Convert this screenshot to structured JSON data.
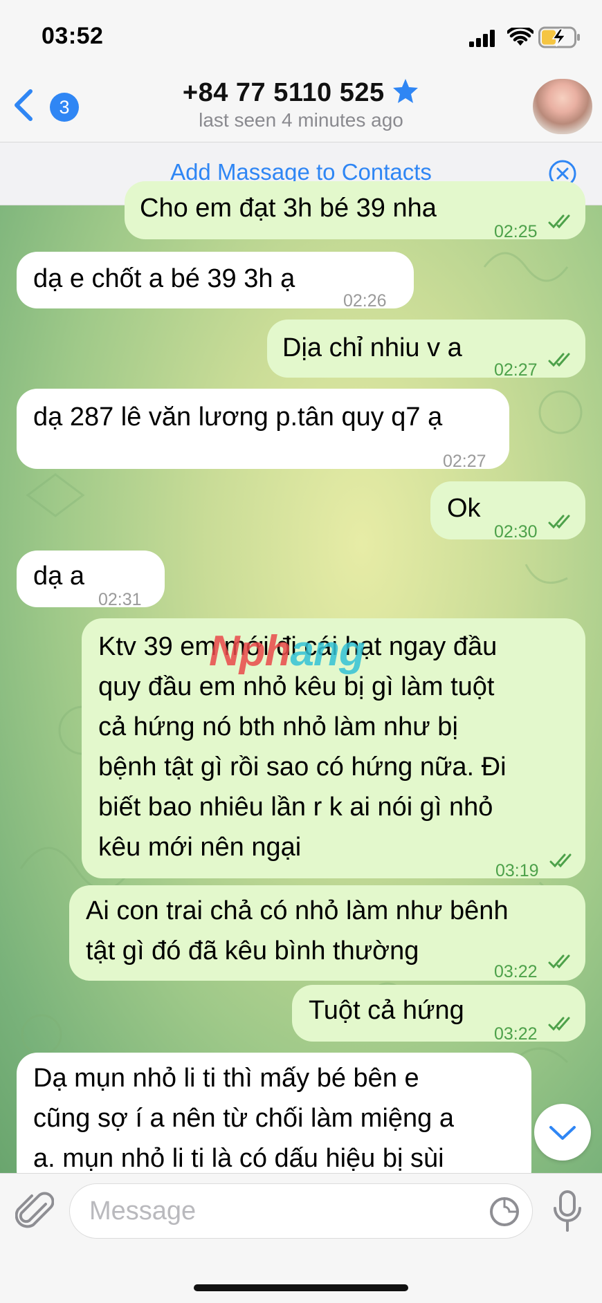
{
  "status_bar": {
    "time": "03:52"
  },
  "header": {
    "back_count": "3",
    "contact_name": "+84 77 5110 525",
    "last_seen": "last seen 4 minutes ago"
  },
  "contact_bar": {
    "add_label": "Add Massage to Contacts"
  },
  "messages": [
    {
      "dir": "out",
      "text": "Cho em đạt 3h bé 39 nha",
      "time": "02:25"
    },
    {
      "dir": "in",
      "text": "dạ e chốt a bé 39 3h ạ",
      "time": "02:26"
    },
    {
      "dir": "out",
      "text": "Dịa chỉ nhiu v a",
      "time": "02:27"
    },
    {
      "dir": "in",
      "text": "dạ 287 lê văn lương p.tân quy q7 ạ",
      "time": "02:27"
    },
    {
      "dir": "out",
      "text": "Ok",
      "time": "02:30"
    },
    {
      "dir": "in",
      "text": "dạ a",
      "time": "02:31"
    },
    {
      "dir": "out",
      "lines": [
        "Ktv 39 em mới đi cái hạt ngay đầu",
        "quy đầu em nhỏ kêu bị gì làm tuột",
        "cả hứng nó bth nhỏ làm như bị",
        "bệnh tật gì rồi sao có hứng nữa. Đi",
        "biết bao nhiêu lần r k ai nói gì nhỏ",
        "kêu mới nên ngại"
      ],
      "time": "03:19"
    },
    {
      "dir": "out",
      "lines": [
        "Ai con trai chả có nhỏ làm như bênh",
        "tật gì đó đã kêu bình thường"
      ],
      "time": "03:22"
    },
    {
      "dir": "out",
      "text": "Tuột cả hứng",
      "time": "03:22"
    },
    {
      "dir": "in",
      "lines": [
        "Dạ mụn nhỏ li ti thì mấy bé bên e",
        "cũng sợ í a nên từ chối làm miệng a",
        "a. mụn nhỏ li ti là có dấu hiệu bị sùi"
      ]
    }
  ],
  "watermark": {
    "part1": "Nph",
    "part2": "ang"
  },
  "input": {
    "placeholder": "Message"
  },
  "icons": [
    "back-chevron-icon",
    "star-icon",
    "close-circle-icon",
    "checkmarks-icon",
    "attach-icon",
    "sticker-icon",
    "mic-icon",
    "chevron-down-icon",
    "signal-icon",
    "wifi-icon",
    "battery-icon"
  ],
  "colors": {
    "accent": "#2f86f4",
    "outgoing_bubble": "#e3f8cc",
    "incoming_bubble": "#ffffff",
    "read_check": "#4da14a"
  }
}
